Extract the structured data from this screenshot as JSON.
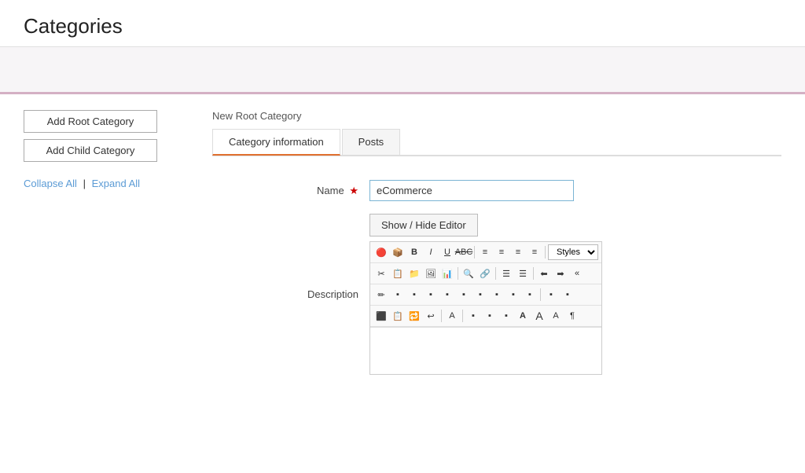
{
  "page": {
    "title": "Categories"
  },
  "left_panel": {
    "add_root_label": "Add Root Category",
    "add_child_label": "Add Child Category",
    "collapse_label": "Collapse All",
    "separator": "|",
    "expand_label": "Expand All"
  },
  "right_panel": {
    "new_root_label": "New Root Category",
    "tabs": [
      {
        "id": "category-info",
        "label": "Category information",
        "active": true
      },
      {
        "id": "posts",
        "label": "Posts",
        "active": false
      }
    ],
    "form": {
      "name_label": "Name",
      "name_value": "eCommerce",
      "name_placeholder": "",
      "description_label": "Description",
      "show_hide_label": "Show / Hide Editor"
    },
    "toolbar": {
      "rows": [
        [
          "🔴",
          "📦",
          "B",
          "I",
          "U",
          "ABC",
          "|",
          "≡",
          "≡",
          "≡",
          "≡",
          "|",
          "Styles"
        ],
        [
          "✂",
          "📋",
          "📁",
          "🖼",
          "📊",
          "|",
          "🔍",
          "🔗",
          "|",
          "☰",
          "☰",
          "|",
          "⬅",
          "➡",
          "«"
        ],
        [
          "✏",
          "⬛",
          "⬛",
          "⬛",
          "⬛",
          "⬛",
          "⬛",
          "⬛",
          "⬛",
          "⬛",
          "|",
          "⬛",
          "⬛"
        ],
        [
          "⬛",
          "📋",
          "🔁",
          "↩",
          "|",
          "A",
          "|",
          "⬛",
          "⬛",
          "⬛",
          "A",
          "A",
          "A",
          "¶"
        ]
      ]
    }
  },
  "colors": {
    "accent_orange": "#e07030",
    "link_blue": "#5b9bd5",
    "border_gray": "#ccc",
    "tab_active_border": "#e07030"
  }
}
